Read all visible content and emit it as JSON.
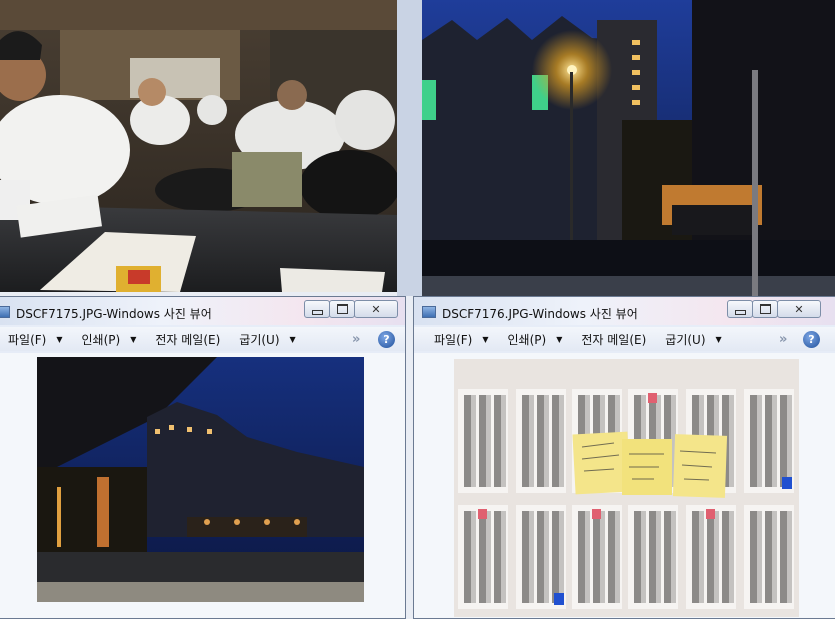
{
  "windows": [
    {
      "title": "DSCF7175.JPG-Windows 사진 뷰어",
      "menu": [
        {
          "label": "파일(F)"
        },
        {
          "label": "인쇄(P)"
        },
        {
          "label": "전자 메일(E)"
        },
        {
          "label": "굽기(U)"
        }
      ],
      "more_glyph": "»",
      "help_glyph": "?",
      "close_glyph": "✕",
      "image_icon": "image-photo-icon"
    },
    {
      "title": "DSCF7176.JPG-Windows 사진 뷰어",
      "menu": [
        {
          "label": "파일(F)"
        },
        {
          "label": "인쇄(P)"
        },
        {
          "label": "전자 메일(E)"
        },
        {
          "label": "굽기(U)"
        }
      ],
      "more_glyph": "»",
      "help_glyph": "?",
      "close_glyph": "✕",
      "image_icon": "image-photo-icon"
    }
  ],
  "colors": {
    "window_border": "#6b7a92",
    "help_blue": "#1f4f9a",
    "night_sky": "#16307e"
  }
}
